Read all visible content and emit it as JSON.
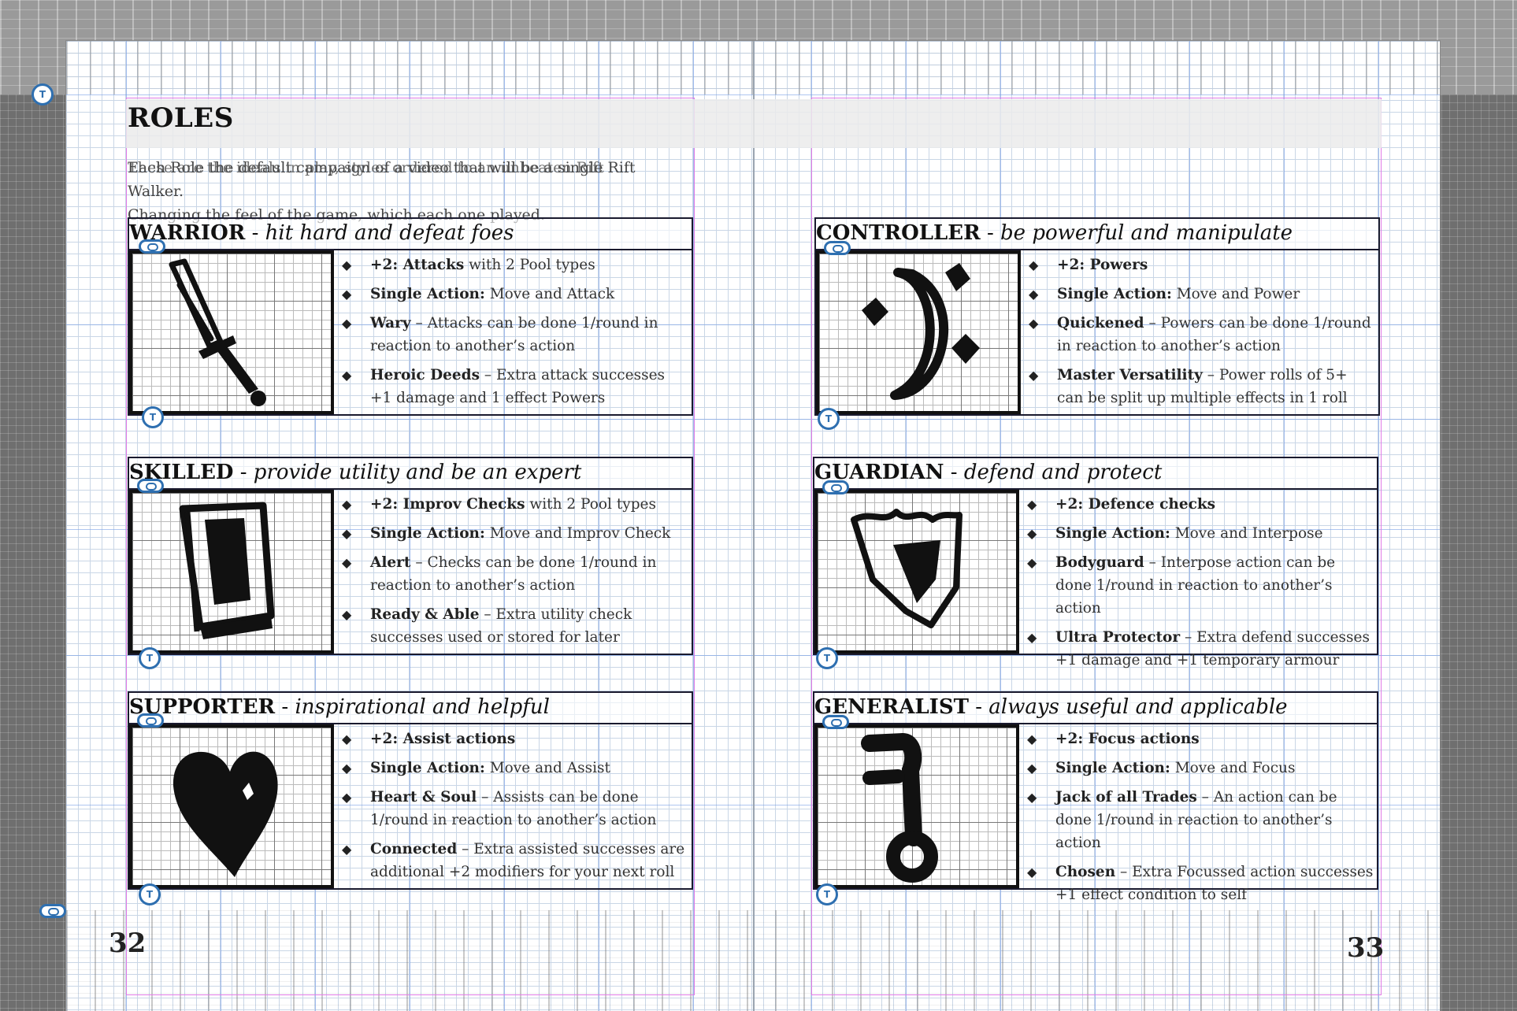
{
  "page": {
    "title": "ROLES",
    "intro_line1": "Each Role the default campaign of a video that will be a single Rift Walker.",
    "intro_line1_overlap": "These are the ideals in play, styles ordered to an unbeaten Rift",
    "intro_line2": "Changing the feel of the game, which each one played.",
    "left_page_number": "32",
    "right_page_number": "33"
  },
  "roles": [
    {
      "name": "WARRIOR",
      "tagline": "hit hard and defeat foes",
      "icon": "sword-icon",
      "abilities": [
        {
          "bold": "+2: Attacks",
          "text": " with 2 Pool types"
        },
        {
          "bold": "Single Action:",
          "text": " Move and Attack"
        },
        {
          "bold": "Wary",
          "text": " – Attacks can be done 1/round in reaction to another’s action"
        },
        {
          "bold": "Heroic Deeds",
          "text": " – Extra attack successes +1 damage and  1 effect Powers"
        }
      ]
    },
    {
      "name": "CONTROLLER",
      "tagline": "be powerful and manipulate",
      "icon": "moon-diamonds-icon",
      "abilities": [
        {
          "bold": "+2: Powers",
          "text": ""
        },
        {
          "bold": "Single Action:",
          "text": " Move and Power"
        },
        {
          "bold": "Quickened",
          "text": " – Powers can be done 1/round in reaction to another’s action"
        },
        {
          "bold": "Master Versatility",
          "text": " – Power rolls of 5+ can be split up multiple effects in 1 roll"
        }
      ]
    },
    {
      "name": "SKILLED",
      "tagline": "provide utility and be an expert",
      "icon": "book-icon",
      "abilities": [
        {
          "bold": "+2: Improv Checks",
          "text": " with 2 Pool types"
        },
        {
          "bold": "Single Action:",
          "text": " Move and Improv Check"
        },
        {
          "bold": "Alert",
          "text": " – Checks can be done 1/round in reaction to another’s action"
        },
        {
          "bold": "Ready & Able",
          "text": " – Extra utility check successes used or stored for later"
        }
      ]
    },
    {
      "name": "GUARDIAN",
      "tagline": "defend and protect",
      "icon": "shield-icon",
      "abilities": [
        {
          "bold": "+2: Defence checks",
          "text": ""
        },
        {
          "bold": "Single Action:",
          "text": " Move and Interpose"
        },
        {
          "bold": "Bodyguard",
          "text": " – Interpose action can be done 1/round in reaction to another’s action"
        },
        {
          "bold": "Ultra Protector",
          "text": " – Extra defend successes +1 damage and  +1 temporary armour"
        }
      ]
    },
    {
      "name": "SUPPORTER",
      "tagline": "inspirational and helpful",
      "icon": "heart-icon",
      "abilities": [
        {
          "bold": "+2: Assist actions",
          "text": ""
        },
        {
          "bold": "Single Action:",
          "text": " Move and Assist"
        },
        {
          "bold": "Heart & Soul",
          "text": " – Assists can be done 1/round in reaction to another’s action"
        },
        {
          "bold": "Connected",
          "text": " – Extra assisted successes are additional +2 modifiers for your next roll"
        }
      ]
    },
    {
      "name": "GENERALIST",
      "tagline": "always useful and applicable",
      "icon": "key-icon",
      "abilities": [
        {
          "bold": "+2: Focus actions",
          "text": ""
        },
        {
          "bold": "Single Action:",
          "text": " Move and Focus"
        },
        {
          "bold": "Jack of all Trades",
          "text": " – An action can be done 1/round in reaction to another’s action"
        },
        {
          "bold": "Chosen",
          "text": " – Extra Focussed action successes +1 effect condition to self"
        }
      ]
    }
  ],
  "separators": {
    "dash": " - ",
    "t_marker": "T"
  }
}
